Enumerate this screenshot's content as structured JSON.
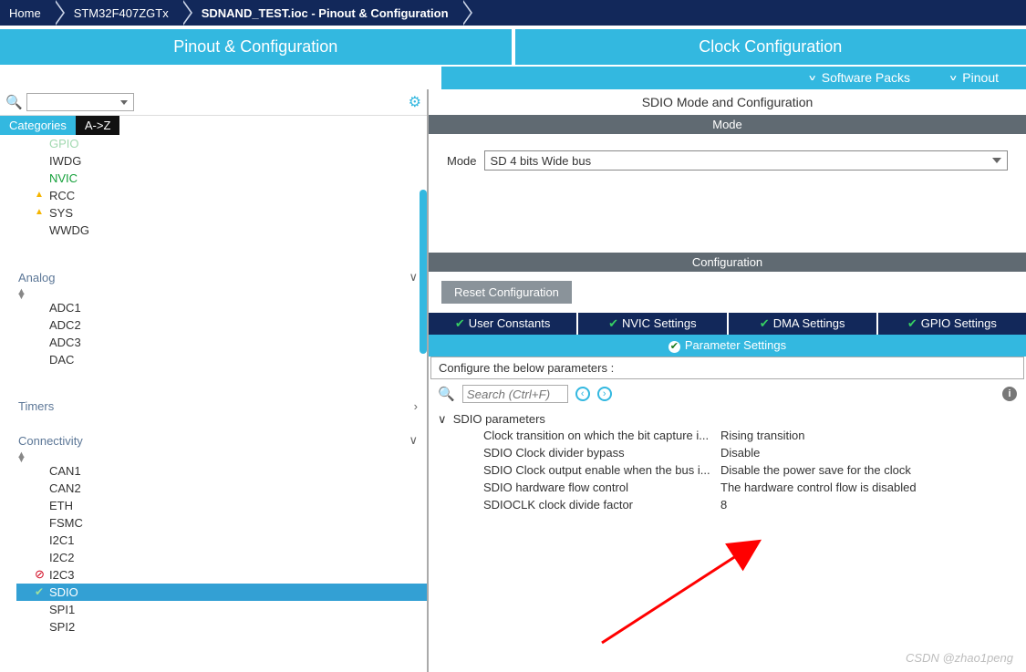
{
  "breadcrumb": [
    "Home",
    "STM32F407ZGTx",
    "SDNAND_TEST.ioc - Pinout & Configuration"
  ],
  "main_tabs": {
    "left": "Pinout & Configuration",
    "right": "Clock Configuration"
  },
  "sub_bar": {
    "packs": "Software Packs",
    "pinout": "Pinout"
  },
  "left_panel": {
    "sort_tabs": {
      "categories": "Categories",
      "az": "A->Z"
    },
    "system_core": [
      "GPIO",
      "IWDG",
      "NVIC",
      "RCC",
      "SYS",
      "WWDG"
    ],
    "sections": {
      "analog": {
        "label": "Analog",
        "items": [
          "ADC1",
          "ADC2",
          "ADC3",
          "DAC"
        ]
      },
      "timers": {
        "label": "Timers"
      },
      "connectivity": {
        "label": "Connectivity",
        "items": [
          "CAN1",
          "CAN2",
          "ETH",
          "FSMC",
          "I2C1",
          "I2C2",
          "I2C3",
          "SDIO",
          "SPI1",
          "SPI2"
        ]
      }
    }
  },
  "right_panel": {
    "title": "SDIO Mode and Configuration",
    "mode_band": "Mode",
    "mode_label": "Mode",
    "mode_value": "SD 4 bits Wide bus",
    "config_band": "Configuration",
    "reset": "Reset Configuration",
    "tabs1": [
      "User Constants",
      "NVIC Settings",
      "DMA Settings",
      "GPIO Settings"
    ],
    "tabs2": "Parameter Settings",
    "configure_text": "Configure the below parameters :",
    "search_ph": "Search (Ctrl+F)",
    "grp": "SDIO parameters",
    "params": [
      {
        "label": "Clock transition on which the bit capture i...",
        "value": "Rising transition"
      },
      {
        "label": "SDIO Clock divider bypass",
        "value": "Disable"
      },
      {
        "label": "SDIO Clock output enable when the bus i...",
        "value": "Disable the power save for the clock"
      },
      {
        "label": "SDIO hardware flow control",
        "value": "The hardware control flow is disabled"
      },
      {
        "label": "SDIOCLK clock divide factor",
        "value": "8"
      }
    ]
  },
  "credit": "CSDN @zhao1peng"
}
